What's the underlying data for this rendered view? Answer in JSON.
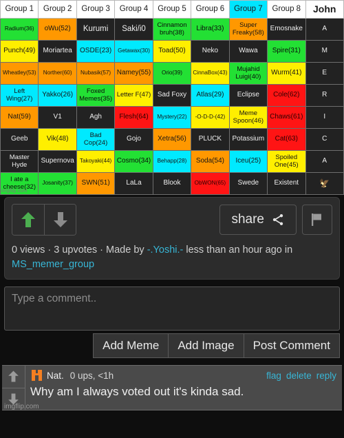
{
  "grid": {
    "headers": [
      {
        "label": "Group 1",
        "highlight": false
      },
      {
        "label": "Group 2",
        "highlight": false
      },
      {
        "label": "Group 3",
        "highlight": false
      },
      {
        "label": "Group 4",
        "highlight": false
      },
      {
        "label": "Group 5",
        "highlight": false
      },
      {
        "label": "Group 6",
        "highlight": false
      },
      {
        "label": "Group 7",
        "highlight": true
      },
      {
        "label": "Group 8",
        "highlight": false
      },
      {
        "label": "John",
        "highlight": false
      }
    ],
    "rows": [
      [
        {
          "text": "Radium(36)",
          "color": "green",
          "size": "sm"
        },
        {
          "text": "oWu(52)",
          "color": "orange",
          "size": "md"
        },
        {
          "text": "Kurumi",
          "color": "dark",
          "size": "lg"
        },
        {
          "text": "Saki/i0",
          "color": "dark",
          "size": "lg"
        },
        {
          "text": "Cinnamon bruh(38)",
          "color": "green",
          "size": "two"
        },
        {
          "text": "Libra(33)",
          "color": "green",
          "size": "md"
        },
        {
          "text": "Super Freaky(58)",
          "color": "orange",
          "size": "two"
        },
        {
          "text": "Emosnake",
          "color": "dark",
          "size": "md"
        },
        {
          "text": "A",
          "color": "dark",
          "size": "md"
        }
      ],
      [
        {
          "text": "Punch(49)",
          "color": "yellow",
          "size": "md"
        },
        {
          "text": "Moriartea",
          "color": "dark",
          "size": "md"
        },
        {
          "text": "OSDE(23)",
          "color": "cyan",
          "size": "md"
        },
        {
          "text": "Getawax(30)",
          "color": "cyan",
          "size": "sm"
        },
        {
          "text": "Toad(50)",
          "color": "yellow",
          "size": "md"
        },
        {
          "text": "Neko",
          "color": "dark",
          "size": "md"
        },
        {
          "text": "Wawa",
          "color": "dark",
          "size": "md"
        },
        {
          "text": "Spire(31)",
          "color": "green",
          "size": "md"
        },
        {
          "text": "M",
          "color": "dark",
          "size": "md"
        }
      ],
      [
        {
          "text": "Wheatley(53)",
          "color": "orange",
          "size": "sm"
        },
        {
          "text": "Norther(60)",
          "color": "orange",
          "size": "sm"
        },
        {
          "text": "Nubasik(57)",
          "color": "orange",
          "size": "sm"
        },
        {
          "text": "Namey(55)",
          "color": "orange",
          "size": "md"
        },
        {
          "text": "Orio(39)",
          "color": "green",
          "size": "sm"
        },
        {
          "text": "CinnaBox(43)",
          "color": "yellow",
          "size": "sm"
        },
        {
          "text": "Mujahid Luigi(40)",
          "color": "green",
          "size": "two"
        },
        {
          "text": "Wurm(41)",
          "color": "yellow",
          "size": "md"
        },
        {
          "text": "E",
          "color": "dark",
          "size": "md"
        }
      ],
      [
        {
          "text": "Left Wing(27)",
          "color": "cyan",
          "size": "two"
        },
        {
          "text": "Yakko(26)",
          "color": "cyan",
          "size": "md"
        },
        {
          "text": "Foxed Memes(35)",
          "color": "green",
          "size": "two"
        },
        {
          "text": "Letter F(47)",
          "color": "yellow",
          "size": "two"
        },
        {
          "text": "Sad Foxy",
          "color": "dark",
          "size": "md"
        },
        {
          "text": "Atlas(29)",
          "color": "cyan",
          "size": "md"
        },
        {
          "text": "Eclipse",
          "color": "dark",
          "size": "md"
        },
        {
          "text": "Cole(62)",
          "color": "red",
          "size": "md"
        },
        {
          "text": "R",
          "color": "dark",
          "size": "md"
        }
      ],
      [
        {
          "text": "Nat(59)",
          "color": "orange",
          "size": "md"
        },
        {
          "text": "V1",
          "color": "dark",
          "size": "md"
        },
        {
          "text": "Agh",
          "color": "dark",
          "size": "md"
        },
        {
          "text": "Flesh(64)",
          "color": "red",
          "size": "md"
        },
        {
          "text": "Mystery(22)",
          "color": "cyan",
          "size": "sm"
        },
        {
          "text": "-O-D-D-(42)",
          "color": "yellow",
          "size": "sm"
        },
        {
          "text": "Meme Spoon(46)",
          "color": "yellow",
          "size": "two"
        },
        {
          "text": "Chaws(61)",
          "color": "red",
          "size": "md"
        },
        {
          "text": "I",
          "color": "dark",
          "size": "md"
        }
      ],
      [
        {
          "text": "Geeb",
          "color": "dark",
          "size": "md"
        },
        {
          "text": "Vik(48)",
          "color": "yellow",
          "size": "md"
        },
        {
          "text": "Bad Cop(24)",
          "color": "cyan",
          "size": "two"
        },
        {
          "text": "Gojo",
          "color": "dark",
          "size": "md"
        },
        {
          "text": "Xetra(56)",
          "color": "orange",
          "size": "md"
        },
        {
          "text": "PLUCK",
          "color": "dark",
          "size": "md"
        },
        {
          "text": "Potassium",
          "color": "dark",
          "size": "md"
        },
        {
          "text": "Cat(63)",
          "color": "red",
          "size": "md"
        },
        {
          "text": "C",
          "color": "dark",
          "size": "md"
        }
      ],
      [
        {
          "text": "Master Hyde",
          "color": "dark",
          "size": "two"
        },
        {
          "text": "Supernova",
          "color": "dark",
          "size": "md"
        },
        {
          "text": "Takoyaki(44)",
          "color": "yellow",
          "size": "sm"
        },
        {
          "text": "Cosmo(34)",
          "color": "green",
          "size": "md"
        },
        {
          "text": "Behapp(28)",
          "color": "cyan",
          "size": "sm"
        },
        {
          "text": "Soda(54)",
          "color": "orange",
          "size": "md"
        },
        {
          "text": "Iceu(25)",
          "color": "cyan",
          "size": "md"
        },
        {
          "text": "Spoiled One(45)",
          "color": "yellow",
          "size": "two"
        },
        {
          "text": "A",
          "color": "dark",
          "size": "md"
        }
      ],
      [
        {
          "text": "I ate a cheese(32)",
          "color": "green",
          "size": "two"
        },
        {
          "text": "Josanity(37)",
          "color": "green",
          "size": "sm"
        },
        {
          "text": "SWN(51)",
          "color": "orange",
          "size": "md"
        },
        {
          "text": "LaLa",
          "color": "dark",
          "size": "md"
        },
        {
          "text": "Blook",
          "color": "dark",
          "size": "md"
        },
        {
          "text": "ObWON(65)",
          "color": "red",
          "size": "sm"
        },
        {
          "text": "Swede",
          "color": "dark",
          "size": "md"
        },
        {
          "text": "Existent",
          "color": "dark",
          "size": "md"
        },
        {
          "text": "🦅",
          "color": "dark",
          "size": "eagle"
        }
      ]
    ],
    "watermark": "imgflip.com"
  },
  "post": {
    "share_label": "share",
    "meta": {
      "views": "0 views",
      "sep1": " · ",
      "upvotes": "3 upvotes",
      "sep2": " · ",
      "made_by": "Made by ",
      "author": "-.Yoshi.-",
      "time": " less than an hour ago in ",
      "stream": "MS_memer_group"
    }
  },
  "comment_form": {
    "placeholder": "Type a comment..",
    "value": "",
    "add_meme_label": "Add Meme",
    "add_image_label": "Add Image",
    "post_label": "Post Comment"
  },
  "comments": [
    {
      "author": "Nat.",
      "ups": "0 ups, <1h",
      "flag": "flag",
      "delete": "delete",
      "reply": "reply",
      "text": "Why am I always voted out it's kinda sad."
    }
  ],
  "watermark": "imgflip.com",
  "colors": {
    "green": "#23e034",
    "yellow": "#ffef00",
    "orange": "#ff9800",
    "cyan": "#00eaff",
    "red": "#ff1414",
    "dark": "#222222",
    "highlight": "#00e5ff",
    "link": "#38b6d6",
    "upvote": "#4caf50"
  }
}
